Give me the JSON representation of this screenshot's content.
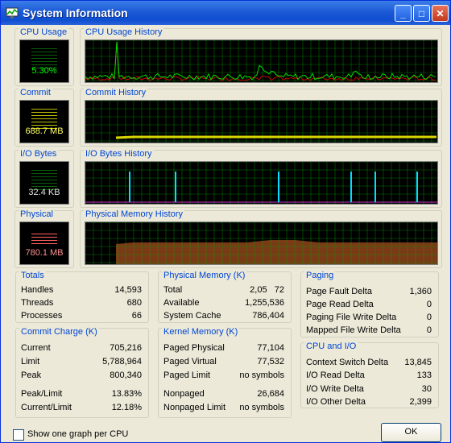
{
  "window": {
    "title": "System Information"
  },
  "colors": {
    "grid": "#00a000",
    "kernel": "#cc0000",
    "total": "#00dd00",
    "commit": "#d8d800",
    "io_other": "#00e0ff",
    "io_spike": "#cc33cc",
    "phys_fill": "#7a3a16"
  },
  "meters": {
    "cpu": {
      "label": "CPU Usage",
      "value": "5.30%"
    },
    "commit": {
      "label": "Commit",
      "value": "688.7 MB"
    },
    "io": {
      "label": "I/O Bytes",
      "value": "32.4  KB"
    },
    "physical": {
      "label": "Physical",
      "value": "780.1 MB"
    }
  },
  "graphs": {
    "cpu": "CPU Usage History",
    "commit": "Commit History",
    "io": "I/O Bytes History",
    "physical": "Physical Memory History"
  },
  "totals": {
    "label": "Totals",
    "rows": [
      {
        "label": "Handles",
        "value": "14,593"
      },
      {
        "label": "Threads",
        "value": "680"
      },
      {
        "label": "Processes",
        "value": "66"
      }
    ]
  },
  "commit_charge": {
    "label": "Commit Charge (K)",
    "rows": [
      {
        "label": "Current",
        "value": "705,216"
      },
      {
        "label": "Limit",
        "value": "5,788,964"
      },
      {
        "label": "Peak",
        "value": "800,340"
      },
      {
        "label": "Peak/Limit",
        "value": "13.83%"
      },
      {
        "label": "Current/Limit",
        "value": "12.18%"
      }
    ]
  },
  "physical_memory": {
    "label": "Physical Memory (K)",
    "rows": [
      {
        "label": "Total",
        "value": "2,05   72"
      },
      {
        "label": "Available",
        "value": "1,255,536"
      },
      {
        "label": "System Cache",
        "value": "786,404"
      }
    ]
  },
  "kernel_memory": {
    "label": "Kernel Memory (K)",
    "rows": [
      {
        "label": "Paged Physical",
        "value": "77,104"
      },
      {
        "label": "Paged Virtual",
        "value": "77,532"
      },
      {
        "label": "Paged Limit",
        "value": "no symbols"
      },
      {
        "label": "Nonpaged",
        "value": "26,684"
      },
      {
        "label": "Nonpaged Limit",
        "value": "no symbols"
      }
    ]
  },
  "paging": {
    "label": "Paging",
    "rows": [
      {
        "label": "Page Fault Delta",
        "value": "1,360"
      },
      {
        "label": "Page Read Delta",
        "value": "0"
      },
      {
        "label": "Paging File Write Delta",
        "value": "0"
      },
      {
        "label": "Mapped File Write Delta",
        "value": "0"
      }
    ]
  },
  "cpu_io": {
    "label": "CPU and I/O",
    "rows": [
      {
        "label": "Context Switch Delta",
        "value": "13,845"
      },
      {
        "label": "I/O Read Delta",
        "value": "133"
      },
      {
        "label": "I/O Write Delta",
        "value": "30"
      },
      {
        "label": "I/O Other Delta",
        "value": "2,399"
      }
    ]
  },
  "checkbox": {
    "label": "Show one graph per CPU",
    "checked": false
  },
  "ok_label": "OK"
}
